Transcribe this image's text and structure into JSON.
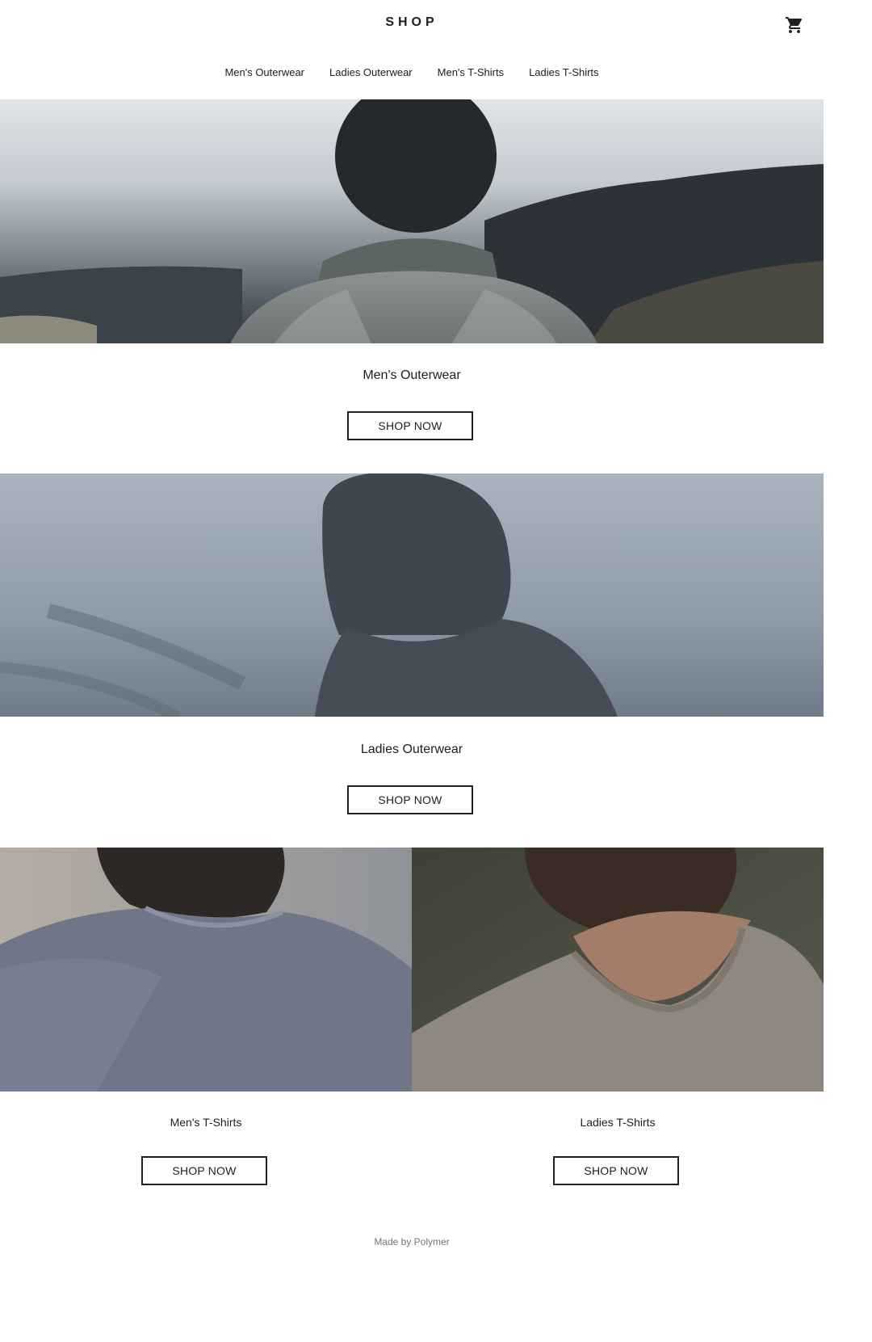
{
  "header": {
    "logo": "SHOP",
    "cart_icon": "shopping-cart-icon"
  },
  "tabs": [
    {
      "label": "Men's Outerwear"
    },
    {
      "label": "Ladies Outerwear"
    },
    {
      "label": "Men's T-Shirts"
    },
    {
      "label": "Ladies T-Shirts"
    }
  ],
  "items": [
    {
      "title": "Men's Outerwear",
      "button": "SHOP NOW",
      "image": "man-in-grey-sweater-photo"
    },
    {
      "title": "Ladies Outerwear",
      "button": "SHOP NOW",
      "image": "woman-in-hood-photo"
    },
    {
      "title": "Men's T-Shirts",
      "button": "SHOP NOW",
      "image": "man-in-blue-tshirt-photo"
    },
    {
      "title": "Ladies T-Shirts",
      "button": "SHOP NOW",
      "image": "woman-in-grey-tshirt-photo"
    }
  ],
  "footer": {
    "text": "Made by Polymer"
  }
}
